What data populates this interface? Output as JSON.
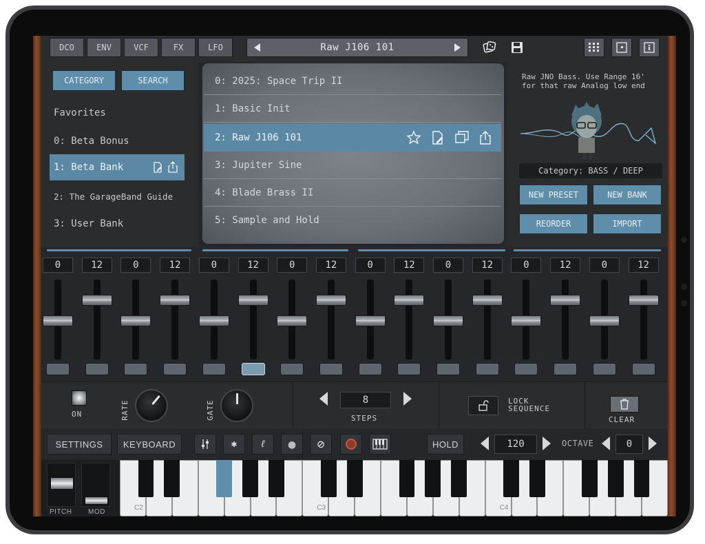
{
  "tabs": [
    "DCO",
    "ENV",
    "VCF",
    "FX",
    "LFO"
  ],
  "preset_name": "Raw J106 101",
  "left": {
    "category_label": "CATEGORY",
    "search_label": "SEARCH",
    "banks": [
      "Favorites",
      "0: Beta Bonus",
      "1: Beta Bank",
      "2: The GarageBand Guide",
      "3: User Bank"
    ]
  },
  "presets": [
    "0: 2025: Space Trip II",
    "1: Basic Init",
    "2: Raw J106 101",
    "3: Jupiter Sine",
    "4: Blade Brass II",
    "5: Sample and Hold"
  ],
  "right": {
    "description": "Raw JNO Bass. Use Range 16' for that raw Analog low end",
    "category_line": "Category: BASS / DEEP",
    "new_preset": "NEW PRESET",
    "new_bank": "NEW BANK",
    "reorder": "REORDER",
    "import": "IMPORT"
  },
  "sequencer": {
    "values": [
      "0",
      "12",
      "0",
      "12",
      "0",
      "12",
      "0",
      "12",
      "0",
      "12",
      "0",
      "12",
      "0",
      "12",
      "0",
      "12"
    ],
    "active_step": 6
  },
  "arp": {
    "on_label": "ON",
    "rate_label": "RATE",
    "gate_label": "GATE",
    "steps_value": "8",
    "steps_label": "STEPS",
    "lock_label": "LOCK SEQUENCE",
    "clear_label": "CLEAR"
  },
  "bottom": {
    "settings": "SETTINGS",
    "keyboard": "KEYBOARD",
    "hold": "HOLD",
    "tempo": "120",
    "octave_label": "OCTAVE",
    "octave_value": "0",
    "bluetooth_glyph": "✱",
    "link_glyph": "ℓ",
    "clock_glyph": "●",
    "stop_glyph": "⊘"
  },
  "keys": {
    "labels": [
      "C2",
      "C3",
      "C4"
    ],
    "pitch_label": "PITCH",
    "mod_label": "MOD"
  },
  "colors": {
    "accent": "#5f8eab",
    "wood": "#8a4d2a"
  }
}
